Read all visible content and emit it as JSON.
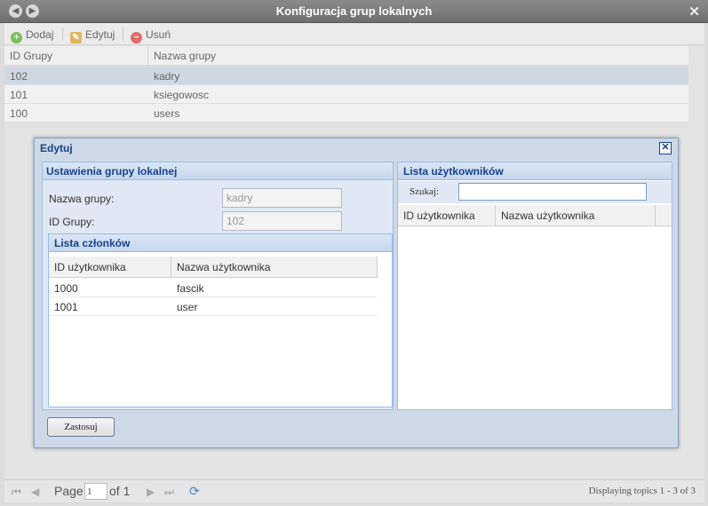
{
  "window": {
    "title": "Konfiguracja grup lokalnych"
  },
  "toolbar": {
    "add_label": "Dodaj",
    "edit_label": "Edytuj",
    "delete_label": "Usuń"
  },
  "main_grid": {
    "columns": [
      "ID Grupy",
      "Nazwa grupy"
    ],
    "rows": [
      {
        "id": "102",
        "name": "kadry"
      },
      {
        "id": "101",
        "name": "ksiegowosc"
      },
      {
        "id": "100",
        "name": "users"
      }
    ]
  },
  "dialog": {
    "title": "Edytuj",
    "settings": {
      "title": "Ustawienia grupy lokalnej",
      "name_label": "Nazwa grupy:",
      "name_value": "kadry",
      "id_label": "ID Grupy:",
      "id_value": "102"
    },
    "members": {
      "title": "Lista członków",
      "columns": [
        "ID użytkownika",
        "Nazwa użytkownika"
      ],
      "rows": [
        {
          "id": "1000",
          "name": "fascik"
        },
        {
          "id": "1001",
          "name": "user"
        }
      ]
    },
    "users": {
      "title": "Lista użytkowników",
      "search_label": "Szukaj:",
      "search_value": "",
      "columns": [
        "ID użytkownika",
        "Nazwa użytkownika"
      ]
    },
    "apply_label": "Zastosuj"
  },
  "pager": {
    "page_label": "Page",
    "page_value": "1",
    "of_label": "of 1",
    "status": "Displaying topics 1 - 3 of 3"
  }
}
